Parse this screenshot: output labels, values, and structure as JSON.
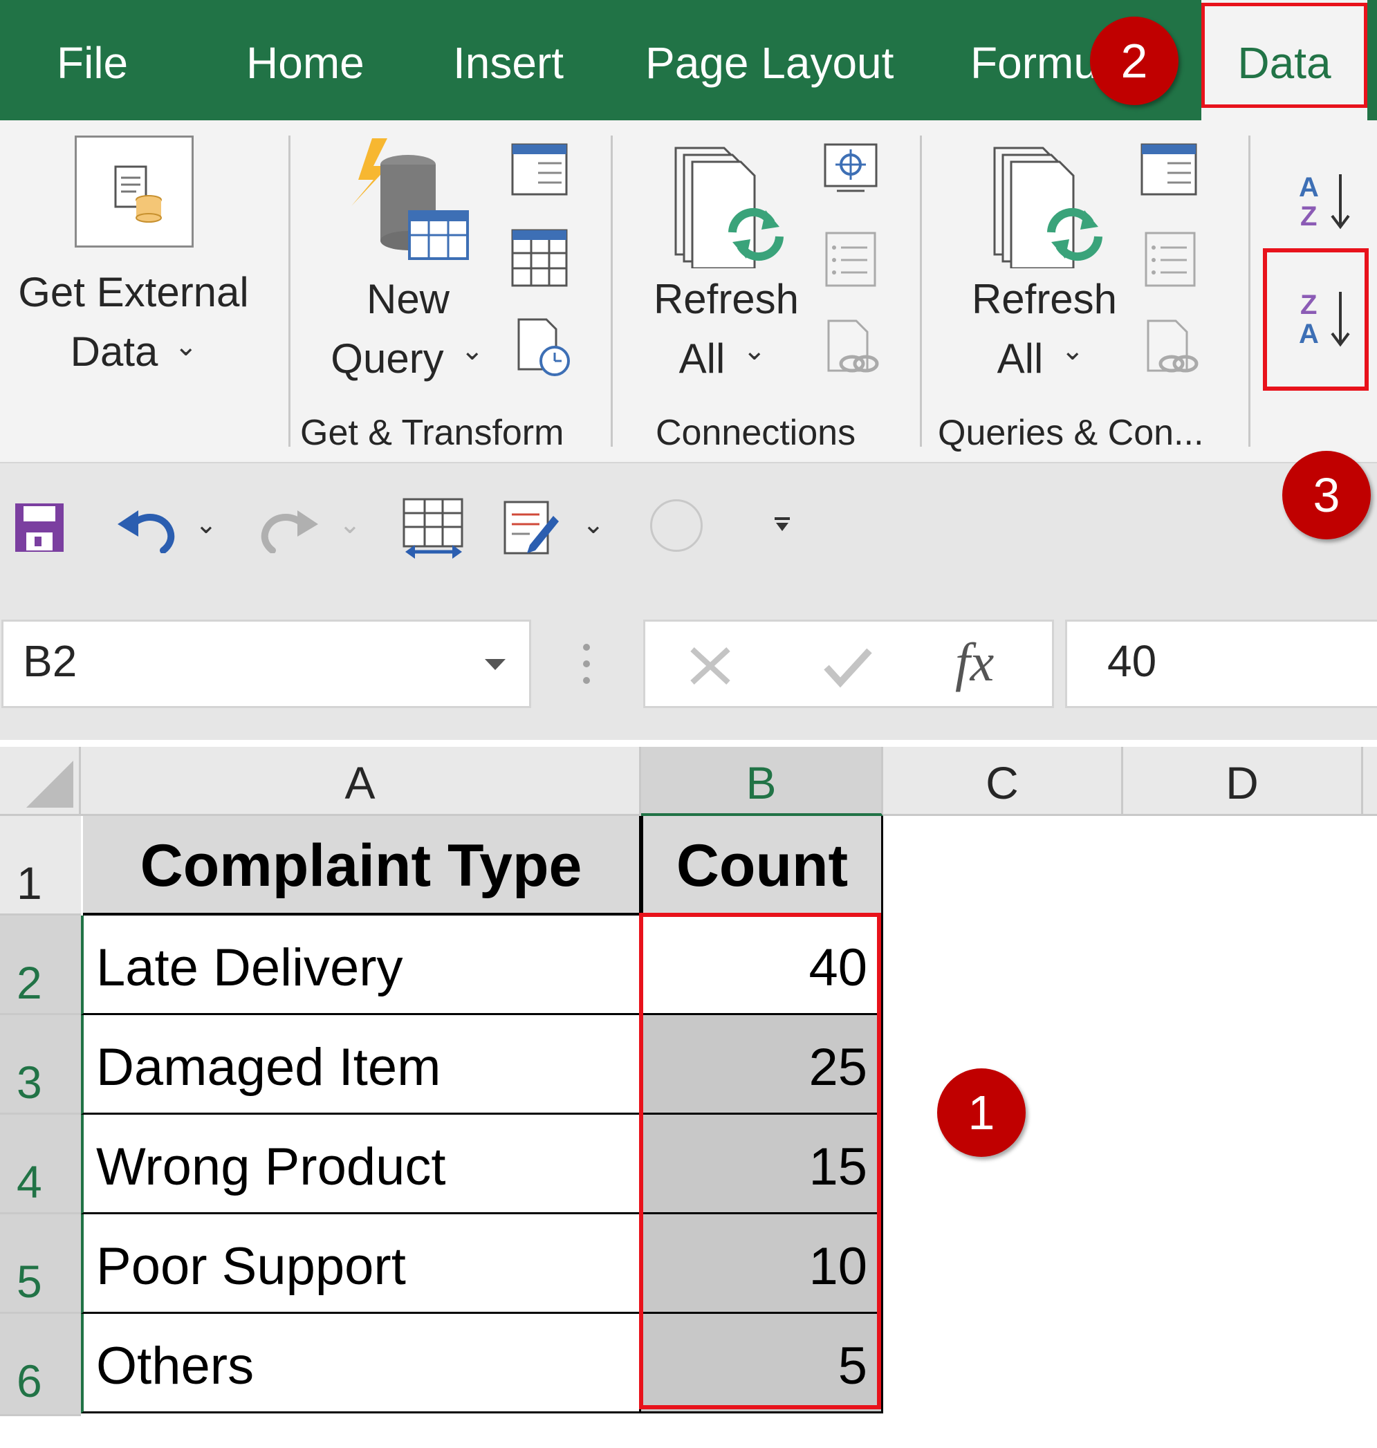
{
  "tabs": {
    "file": "File",
    "home": "Home",
    "insert": "Insert",
    "page_layout": "Page Layout",
    "formulas": "Formu",
    "data": "Data"
  },
  "ribbon": {
    "get_external_line1": "Get External",
    "get_external_line2": "Data",
    "new_query_line1": "New",
    "new_query_line2": "Query",
    "refresh_all_line1": "Refresh",
    "refresh_all_line2": "All",
    "refresh_all2_line1": "Refresh",
    "refresh_all2_line2": "All",
    "group_get_transform": "Get & Transform",
    "group_connections": "Connections",
    "group_queries": "Queries & Con...",
    "sort_az_icon": "sort-a-to-z-icon",
    "sort_za_icon": "sort-z-to-a-icon"
  },
  "formula_bar": {
    "name_box": "B2",
    "formula": "40"
  },
  "sheet": {
    "columns": [
      "A",
      "B",
      "C",
      "D"
    ],
    "rows": [
      "1",
      "2",
      "3",
      "4",
      "5",
      "6"
    ],
    "header": {
      "a": "Complaint Type",
      "b": "Count"
    },
    "data": [
      {
        "a": "Late Delivery",
        "b": "40"
      },
      {
        "a": "Damaged Item",
        "b": "25"
      },
      {
        "a": "Wrong Product",
        "b": "15"
      },
      {
        "a": "Poor Support",
        "b": "10"
      },
      {
        "a": "Others",
        "b": "5"
      }
    ]
  },
  "callouts": {
    "one": "1",
    "two": "2",
    "three": "3"
  },
  "colors": {
    "excel_green": "#217346",
    "highlight_red": "#e8121b",
    "badge_red": "#c00000",
    "selection_gray": "#c8c8c8"
  }
}
